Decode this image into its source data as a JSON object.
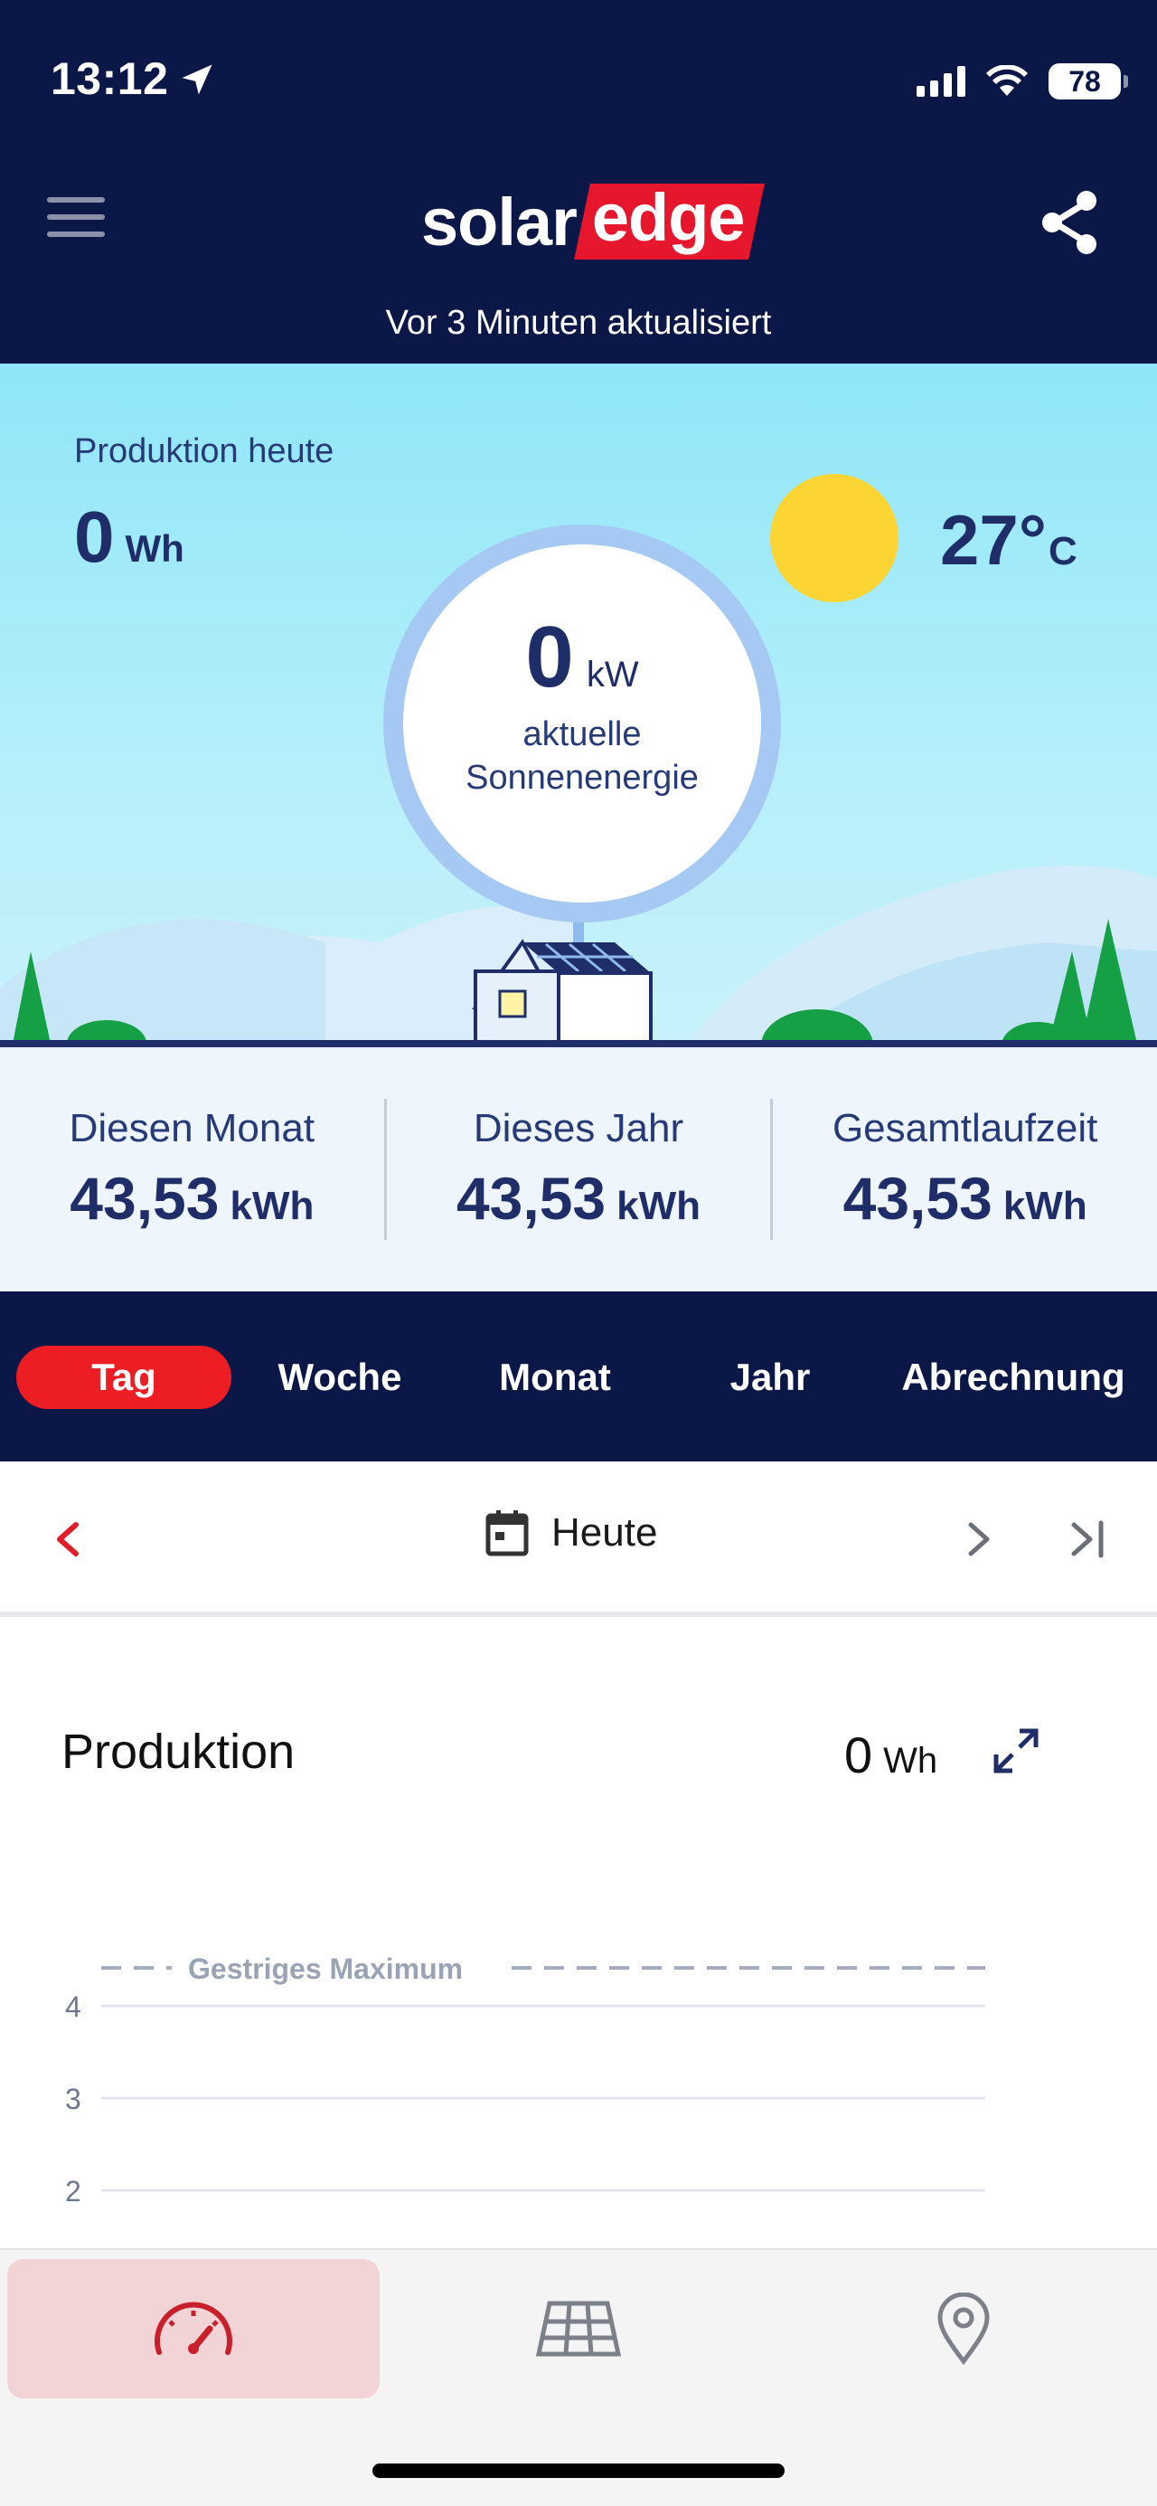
{
  "status_bar": {
    "time": "13:12",
    "battery": "78"
  },
  "header": {
    "logo_solar": "solar",
    "logo_edge": "edge",
    "updated": "Vor 3 Minuten aktualisiert"
  },
  "hero": {
    "production_label": "Produktion heute",
    "production_value": "0",
    "production_unit": "Wh",
    "temperature_value": "27°",
    "temperature_unit": "C",
    "power_value": "0",
    "power_unit": "kW",
    "power_label_line1": "aktuelle",
    "power_label_line2": "Sonnenenergie"
  },
  "stats": [
    {
      "label": "Diesen Monat",
      "value": "43,53",
      "unit": "kWh"
    },
    {
      "label": "Dieses Jahr",
      "value": "43,53",
      "unit": "kWh"
    },
    {
      "label": "Gesamtlaufzeit",
      "value": "43,53",
      "unit": "kWh"
    }
  ],
  "tabs": [
    "Tag",
    "Woche",
    "Monat",
    "Jahr",
    "Abrechnung"
  ],
  "active_tab": "Tag",
  "date_nav": {
    "label": "Heute"
  },
  "production": {
    "title": "Produktion",
    "value": "0",
    "unit": "Wh"
  },
  "chart_data": {
    "type": "line",
    "title": "",
    "xlabel": "",
    "ylabel": "",
    "y_ticks": [
      "4",
      "3",
      "2"
    ],
    "reference_line": {
      "label": "Gestriges Maximum"
    },
    "series": [],
    "grid": true
  },
  "bottom_nav": [
    {
      "name": "Dashboard",
      "icon": "gauge-icon",
      "active": true
    },
    {
      "name": "Layout",
      "icon": "solar-panel-icon",
      "active": false
    },
    {
      "name": "Standort",
      "icon": "location-pin-icon",
      "active": false
    }
  ],
  "colors": {
    "header_bg": "#0b1746",
    "accent_red": "#ed1d24",
    "sky": "#8fe6f9",
    "sun": "#fcd535",
    "text_blue": "#1f2d68"
  }
}
